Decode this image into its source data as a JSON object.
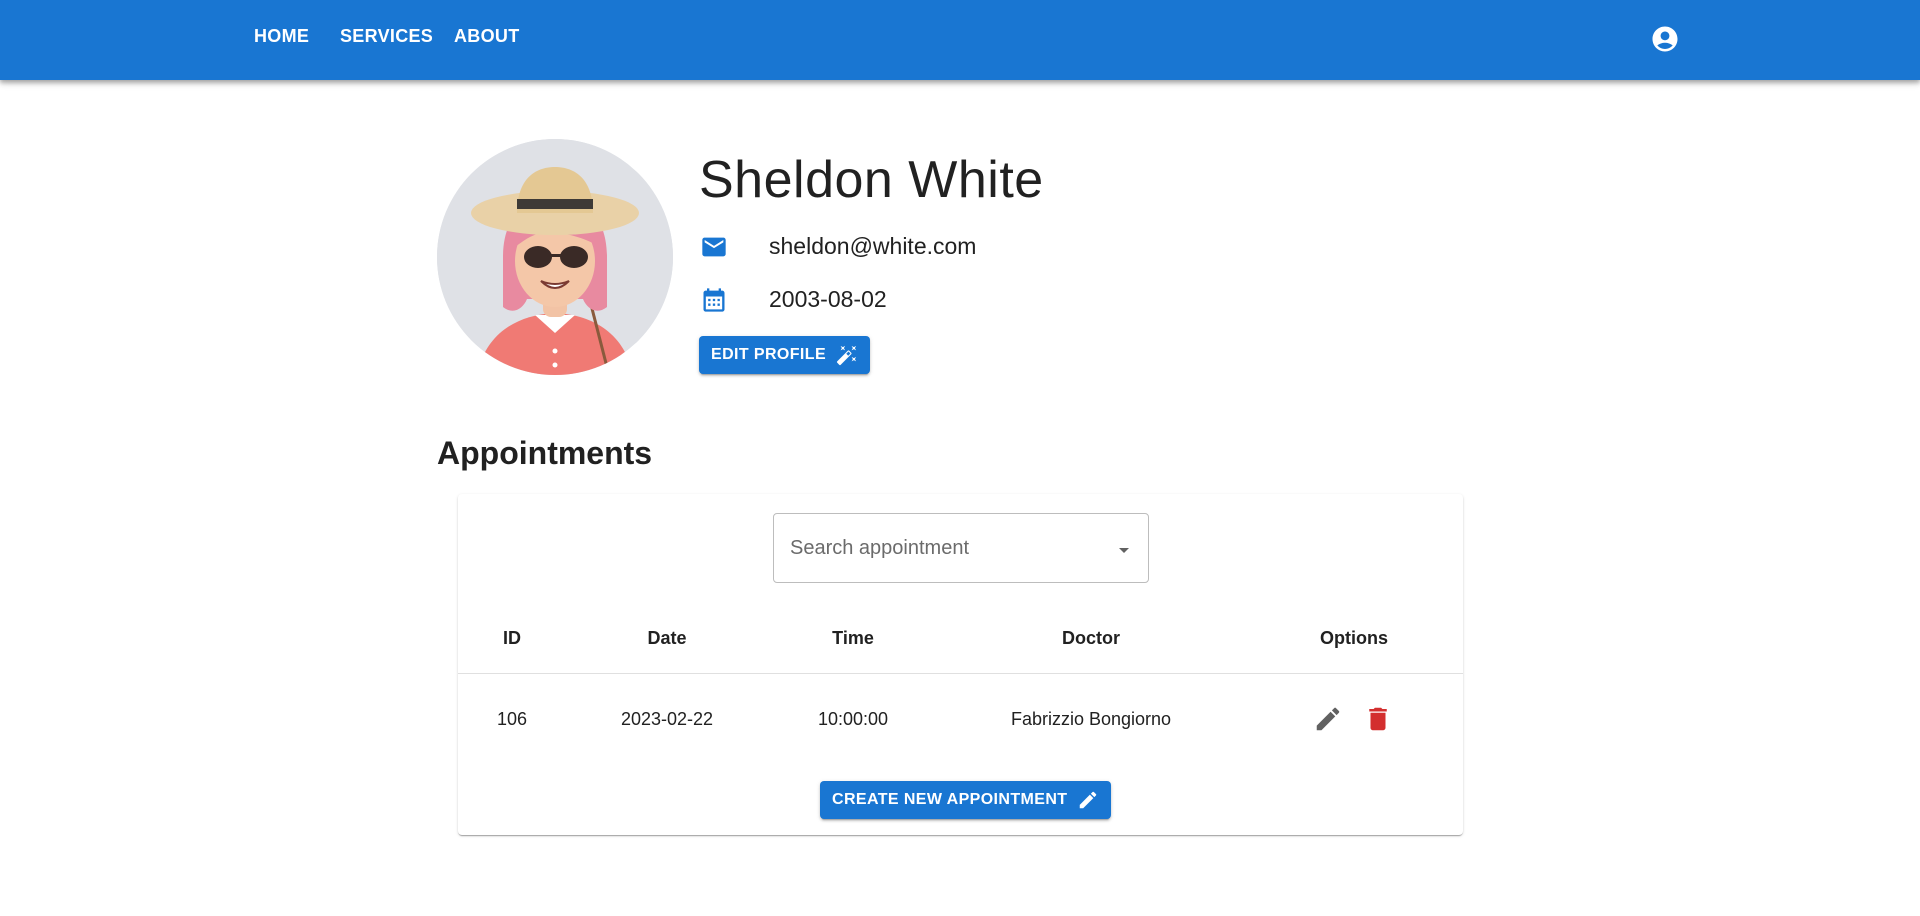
{
  "nav": {
    "items": [
      {
        "label": "HOME"
      },
      {
        "label": "SERVICES"
      },
      {
        "label": "ABOUT"
      }
    ],
    "account_icon": "account-circle-icon"
  },
  "profile": {
    "name": "Sheldon White",
    "email": "sheldon@white.com",
    "birthdate": "2003-08-02",
    "email_icon": "mail-icon",
    "date_icon": "calendar-icon",
    "edit_button": {
      "label": "EDIT PROFILE",
      "icon": "magic-wand-icon"
    }
  },
  "appointments": {
    "title": "Appointments",
    "search": {
      "placeholder": "Search appointment",
      "value": ""
    },
    "columns": [
      "ID",
      "Date",
      "Time",
      "Doctor",
      "Options"
    ],
    "rows": [
      {
        "id": "106",
        "date": "2023-02-22",
        "time": "10:00:00",
        "doctor": "Fabrizzio Bongiorno"
      }
    ],
    "row_actions": {
      "edit_icon": "pencil-icon",
      "delete_icon": "trash-icon"
    },
    "create_button": {
      "label": "CREATE NEW APPOINTMENT",
      "icon": "pencil-icon"
    }
  },
  "colors": {
    "primary": "#1976d2",
    "danger": "#d32f2f",
    "muted_icon": "#616161"
  }
}
